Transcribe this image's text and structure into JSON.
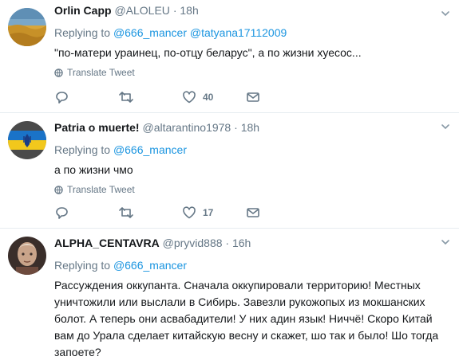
{
  "tweets": [
    {
      "name": "Orlin Capp",
      "handle": "@ALOLEU",
      "separator": "·",
      "time": "18h",
      "replying_to": "Replying to",
      "mentions": [
        "@666_mancer",
        "@tatyana17112009"
      ],
      "text": "\"по-матери ураинец, по-отцу беларус\", а по жизни хуесос...",
      "translate": "Translate Tweet",
      "likes": "40",
      "icons": [
        "reply-icon",
        "retweet-icon",
        "like-icon",
        "message-icon"
      ]
    },
    {
      "name": "Patria o muerte!",
      "handle": "@altarantino1978",
      "separator": "·",
      "time": "18h",
      "replying_to": "Replying to",
      "mentions": [
        "@666_mancer"
      ],
      "text": "а по жизни чмо",
      "translate": "Translate Tweet",
      "likes": "17",
      "icons": [
        "reply-icon",
        "retweet-icon",
        "like-icon",
        "message-icon"
      ]
    },
    {
      "name": "ALPHA_CENTAVRA",
      "handle": "@pryvid888",
      "separator": "·",
      "time": "16h",
      "replying_to": "Replying to",
      "mentions": [
        "@666_mancer"
      ],
      "text": "Рассуждения оккупанта. Сначала оккупировали территорию! Местных уничтожили или выслали в Сибирь. Завезли рукожопых из мокшанских болот. А теперь они асвабадители! У них адин язык! Ниччё! Скоро Китай вам до Урала сделает китайскую весну и скажет, шо так и было! Шо тогда запоете?"
    }
  ],
  "colors": {
    "link": "#1b95e0",
    "secondary": "#657786",
    "border": "#e6ecf0",
    "text": "#14171a"
  }
}
